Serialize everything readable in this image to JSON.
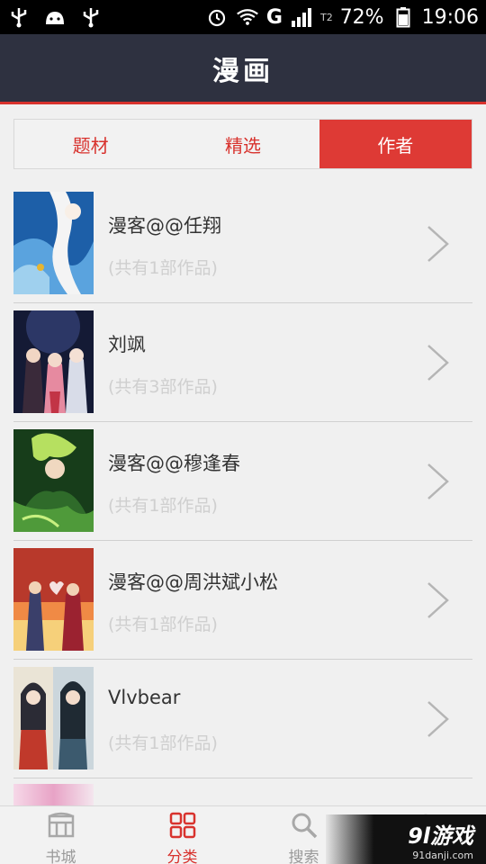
{
  "status_bar": {
    "battery": "72%",
    "time": "19:06",
    "network": "G",
    "signal_badge": "T2",
    "icons": [
      "usb-icon",
      "android-icon",
      "usb-icon",
      "alarm-icon",
      "wifi-icon",
      "signal-icon",
      "battery-icon"
    ]
  },
  "header": {
    "title": "漫画"
  },
  "tabs": [
    {
      "label": "题材",
      "active": false
    },
    {
      "label": "精选",
      "active": false
    },
    {
      "label": "作者",
      "active": true
    }
  ],
  "authors": [
    {
      "name": "漫客@@任翔",
      "count": "(共有1部作品)",
      "thumb_colors": [
        "#1d5fa8",
        "#9fd0ee",
        "#f4f4f4"
      ]
    },
    {
      "name": "刘飒",
      "count": "(共有3部作品)",
      "thumb_colors": [
        "#141a35",
        "#7a8bb0",
        "#e68aa0"
      ]
    },
    {
      "name": "漫客@@穆逢春",
      "count": "(共有1部作品)",
      "thumb_colors": [
        "#173d1a",
        "#4f9a3a",
        "#b6e060"
      ]
    },
    {
      "name": "漫客@@周洪斌小松",
      "count": "(共有1部作品)",
      "thumb_colors": [
        "#b8392b",
        "#f08a45",
        "#f6d07a"
      ]
    },
    {
      "name": "Vlvbear",
      "count": "(共有1部作品)",
      "thumb_colors": [
        "#eae4d6",
        "#c0392b",
        "#3c5a6e"
      ]
    }
  ],
  "bottom_nav": [
    {
      "label": "书城",
      "icon": "bookstore-icon",
      "active": false
    },
    {
      "label": "分类",
      "icon": "category-icon",
      "active": true
    },
    {
      "label": "搜索",
      "icon": "search-icon",
      "active": false
    },
    {
      "label": "",
      "icon": "more-icon",
      "active": false
    }
  ],
  "watermark": {
    "main": "9l游戏",
    "sub": "91danji.com"
  },
  "colors": {
    "accent": "#de3a35",
    "header_bg": "#2e3140",
    "bg": "#f0f0f0"
  }
}
